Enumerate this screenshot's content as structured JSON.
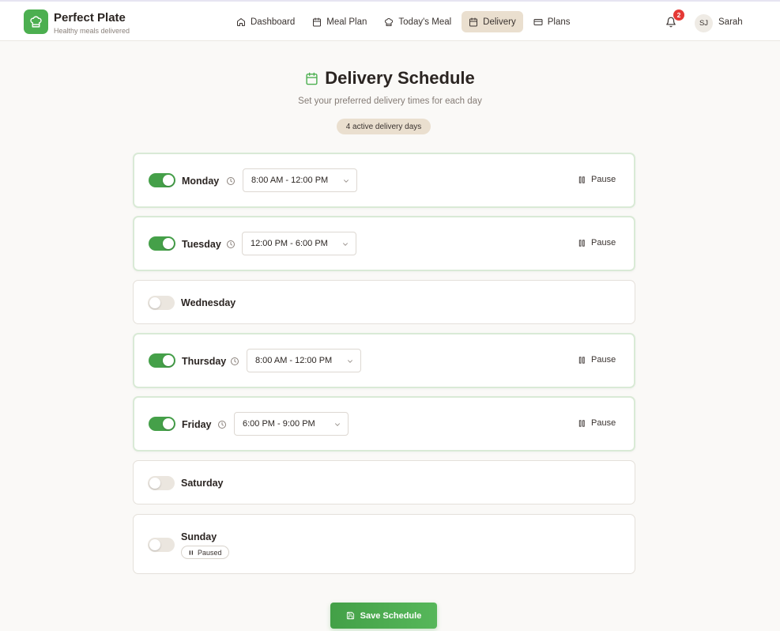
{
  "brand": {
    "name": "Perfect Plate",
    "tagline": "Healthy meals delivered",
    "accent": "#4caf50"
  },
  "nav": [
    {
      "label": "Dashboard",
      "icon": "home-icon"
    },
    {
      "label": "Meal Plan",
      "icon": "calendar-icon"
    },
    {
      "label": "Today's Meal",
      "icon": "chef-hat-icon"
    },
    {
      "label": "Delivery",
      "icon": "calendar-icon",
      "active": true
    },
    {
      "label": "Plans",
      "icon": "credit-card-icon"
    }
  ],
  "notifications": {
    "count": "2"
  },
  "user": {
    "initials": "SJ",
    "name": "Sarah"
  },
  "page": {
    "title": "Delivery Schedule",
    "subtitle": "Set your preferred delivery times for each day",
    "active_days": "4 active delivery days"
  },
  "days": [
    {
      "name": "Monday",
      "enabled": true,
      "time": "8:00 AM - 12:00 PM",
      "pause_label": "Pause"
    },
    {
      "name": "Tuesday",
      "enabled": true,
      "time": "12:00 PM - 6:00 PM",
      "pause_label": "Pause"
    },
    {
      "name": "Wednesday",
      "enabled": false
    },
    {
      "name": "Thursday",
      "enabled": true,
      "time": "8:00 AM - 12:00 PM",
      "pause_label": "Pause"
    },
    {
      "name": "Friday",
      "enabled": true,
      "time": "6:00 PM - 9:00 PM",
      "pause_label": "Pause"
    },
    {
      "name": "Saturday",
      "enabled": false
    },
    {
      "name": "Sunday",
      "enabled": false,
      "status": "Paused"
    }
  ],
  "save_label": "Save Schedule"
}
